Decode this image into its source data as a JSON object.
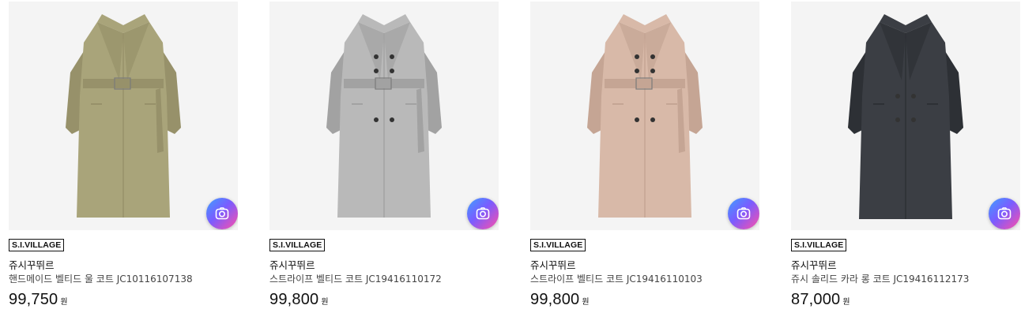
{
  "products": [
    {
      "badge": "S.I.VILLAGE",
      "brand": "쥬시꾸뛰르",
      "name": "핸드메이드 벨티드 울 코트 JC10116107138",
      "price": "99,750",
      "currency": "원",
      "coat_color": "#a9a47a",
      "coat_shade": "#97916a",
      "style": "single-belted"
    },
    {
      "badge": "S.I.VILLAGE",
      "brand": "쥬시꾸뛰르",
      "name": "스트라이프 벨티드 코트 JC19416110172",
      "price": "99,800",
      "currency": "원",
      "coat_color": "#b9b9b9",
      "coat_shade": "#a2a2a2",
      "style": "double-belted"
    },
    {
      "badge": "S.I.VILLAGE",
      "brand": "쥬시꾸뛰르",
      "name": "스트라이프 벨티드 코트 JC19416110103",
      "price": "99,800",
      "currency": "원",
      "coat_color": "#d8b9a8",
      "coat_shade": "#c5a594",
      "style": "double-belted"
    },
    {
      "badge": "S.I.VILLAGE",
      "brand": "쥬시꾸뛰르",
      "name": "쥬시 솔리드 카라 롱 코트 JC19416112173",
      "price": "87,000",
      "currency": "원",
      "coat_color": "#3b3e44",
      "coat_shade": "#2d3035",
      "style": "double-long"
    }
  ],
  "icons": {
    "image_search": "camera-lens-icon"
  }
}
